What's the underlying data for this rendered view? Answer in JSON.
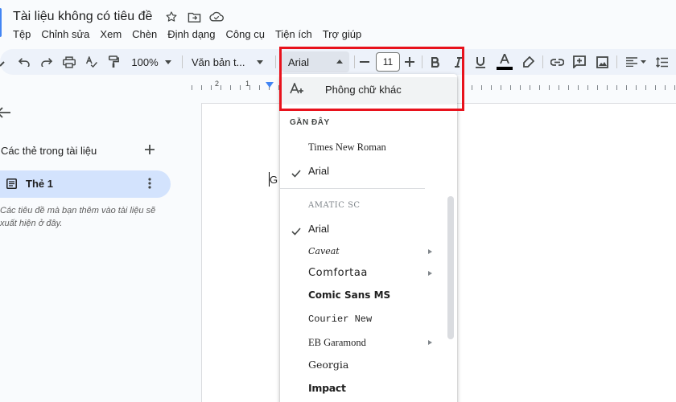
{
  "document": {
    "title": "Tài liệu không có tiêu đề"
  },
  "menu": [
    "Tệp",
    "Chỉnh sửa",
    "Xem",
    "Chèn",
    "Định dạng",
    "Công cụ",
    "Tiện ích",
    "Trợ giúp"
  ],
  "toolbar": {
    "zoom": "100%",
    "style": "Văn bản t...",
    "font": "Arial",
    "font_size": "11"
  },
  "ruler": {
    "numbers": [
      "2",
      "1"
    ]
  },
  "outline": {
    "heading": "Các thẻ trong tài liệu",
    "tab_label": "Thẻ 1",
    "hint": "Các tiêu đề mà bạn thêm vào tài liệu sẽ xuất hiện ở đây."
  },
  "page": {
    "text": "G"
  },
  "font_menu": {
    "more_fonts": "Phông chữ khác",
    "recent_heading": "GẦN ĐÂY",
    "recent": [
      {
        "label": "Times New Roman",
        "checked": false
      },
      {
        "label": "Arial",
        "checked": true
      }
    ],
    "all": [
      {
        "label": "AMATIC SC",
        "checked": false,
        "submenu": false
      },
      {
        "label": "Arial",
        "checked": true,
        "submenu": false
      },
      {
        "label": "Caveat",
        "checked": false,
        "submenu": true
      },
      {
        "label": "Comfortaa",
        "checked": false,
        "submenu": true
      },
      {
        "label": "Comic Sans MS",
        "checked": false,
        "submenu": false
      },
      {
        "label": "Courier New",
        "checked": false,
        "submenu": false
      },
      {
        "label": "EB Garamond",
        "checked": false,
        "submenu": true
      },
      {
        "label": "Georgia",
        "checked": false,
        "submenu": false
      },
      {
        "label": "Impact",
        "checked": false,
        "submenu": false
      }
    ]
  },
  "colors": {
    "accent": "#0b57d0",
    "highlight_box": "#e8121c",
    "toolbar_bg": "#edf2fa",
    "tab_chip": "#d3e3fd"
  }
}
